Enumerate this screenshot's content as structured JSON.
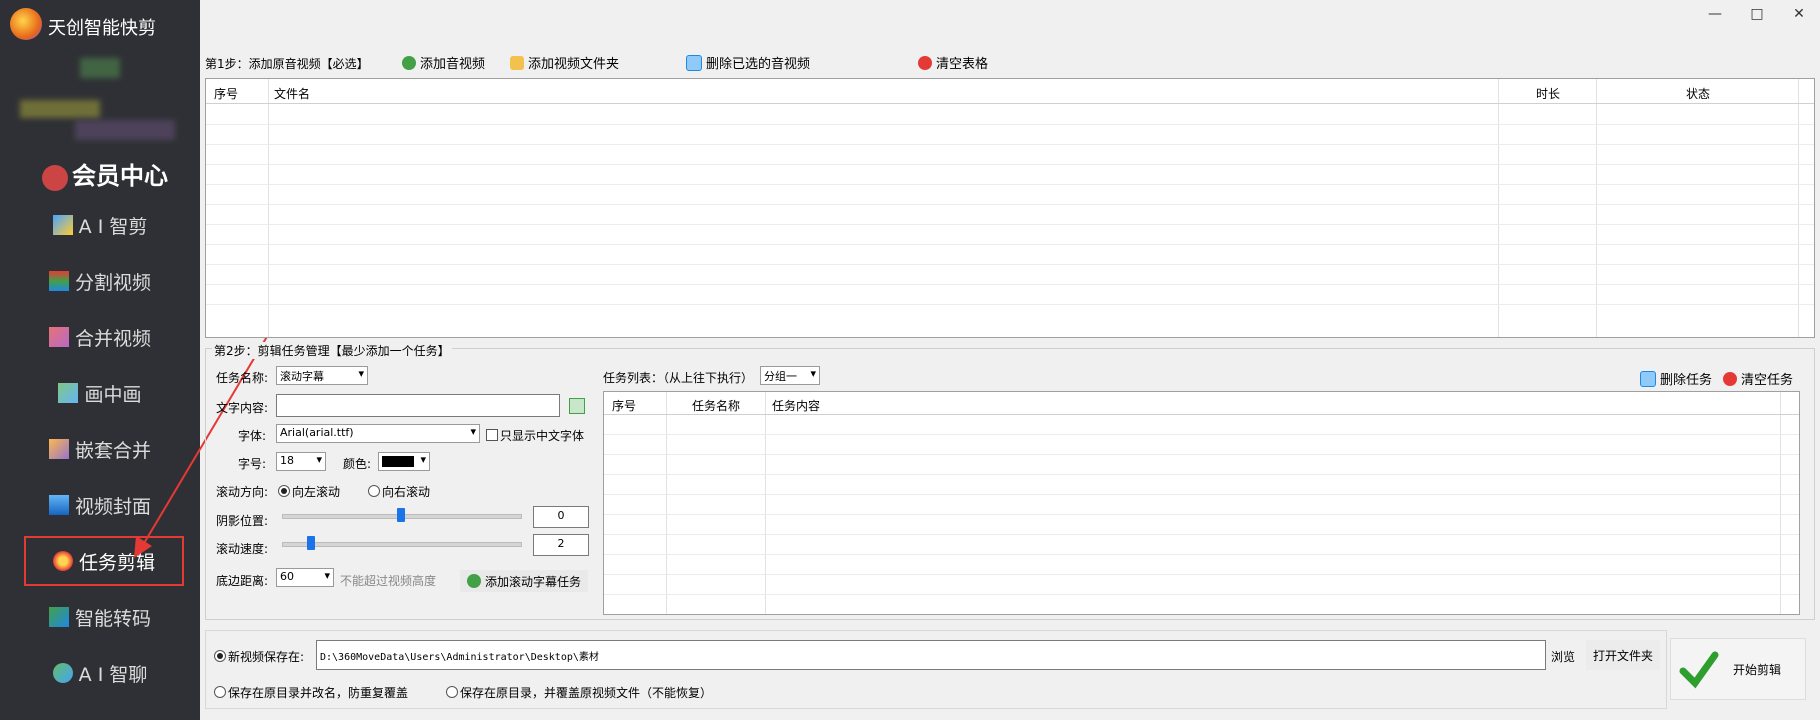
{
  "app": {
    "title": "天创智能快剪"
  },
  "sidebar": {
    "member": "会员中心",
    "items": [
      {
        "label": "A I 智剪",
        "icon": "ai-clip-icon"
      },
      {
        "label": "分割视频",
        "icon": "split-video-icon"
      },
      {
        "label": "合并视频",
        "icon": "merge-video-icon"
      },
      {
        "label": "画中画",
        "icon": "pip-icon"
      },
      {
        "label": "嵌套合并",
        "icon": "nested-merge-icon"
      },
      {
        "label": "视频封面",
        "icon": "video-cover-icon"
      },
      {
        "label": "任务剪辑",
        "icon": "task-clip-icon",
        "active": true
      },
      {
        "label": "智能转码",
        "icon": "transcode-icon"
      },
      {
        "label": "A I 智聊",
        "icon": "ai-chat-icon"
      }
    ]
  },
  "window": {
    "minimize": "—",
    "maximize": "□",
    "close": "✕"
  },
  "step1": {
    "label": "第1步：添加原音视频【必选】",
    "add_audio_video": "添加音视频",
    "add_folder": "添加视频文件夹",
    "delete_selected": "删除已选的音视频",
    "clear_table": "清空表格",
    "columns": [
      "序号",
      "文件名",
      "时长",
      "状态"
    ]
  },
  "step2": {
    "label": "第2步：剪辑任务管理【最少添加一个任务】",
    "task_name_label": "任务名称:",
    "task_name_value": "滚动字幕",
    "text_content_label": "文字内容:",
    "text_content_value": "",
    "font_label": "字体:",
    "font_value": "Arial(arial.ttf)",
    "only_cn_font": "只显示中文字体",
    "size_label": "字号:",
    "size_value": "18",
    "color_label": "颜色:",
    "color_value": "#000000",
    "direction_label": "滚动方向:",
    "dir_left": "向左滚动",
    "dir_right": "向右滚动",
    "shadow_label": "阴影位置:",
    "shadow_value": "0",
    "shadow_fraction": 0.5,
    "speed_label": "滚动速度:",
    "speed_value": "2",
    "speed_fraction": 0.12,
    "bottom_label": "底边距离:",
    "bottom_value": "60",
    "bottom_hint": "不能超过视频高度",
    "add_task": "添加滚动字幕任务",
    "task_list_label": "任务列表：（从上往下执行）",
    "group_value": "分组一",
    "delete_task": "删除任务",
    "clear_task": "清空任务",
    "task_columns": [
      "序号",
      "任务名称",
      "任务内容"
    ]
  },
  "output": {
    "new_save_label": "新视频保存在:",
    "path": "D:\\360MoveData\\Users\\Administrator\\Desktop\\素材",
    "browse": "浏览",
    "open_folder": "打开文件夹",
    "opt_rename": "保存在原目录并改名，防重复覆盖",
    "opt_overwrite": "保存在原目录，并覆盖原视频文件（不能恢复）",
    "start": "开始剪辑"
  }
}
